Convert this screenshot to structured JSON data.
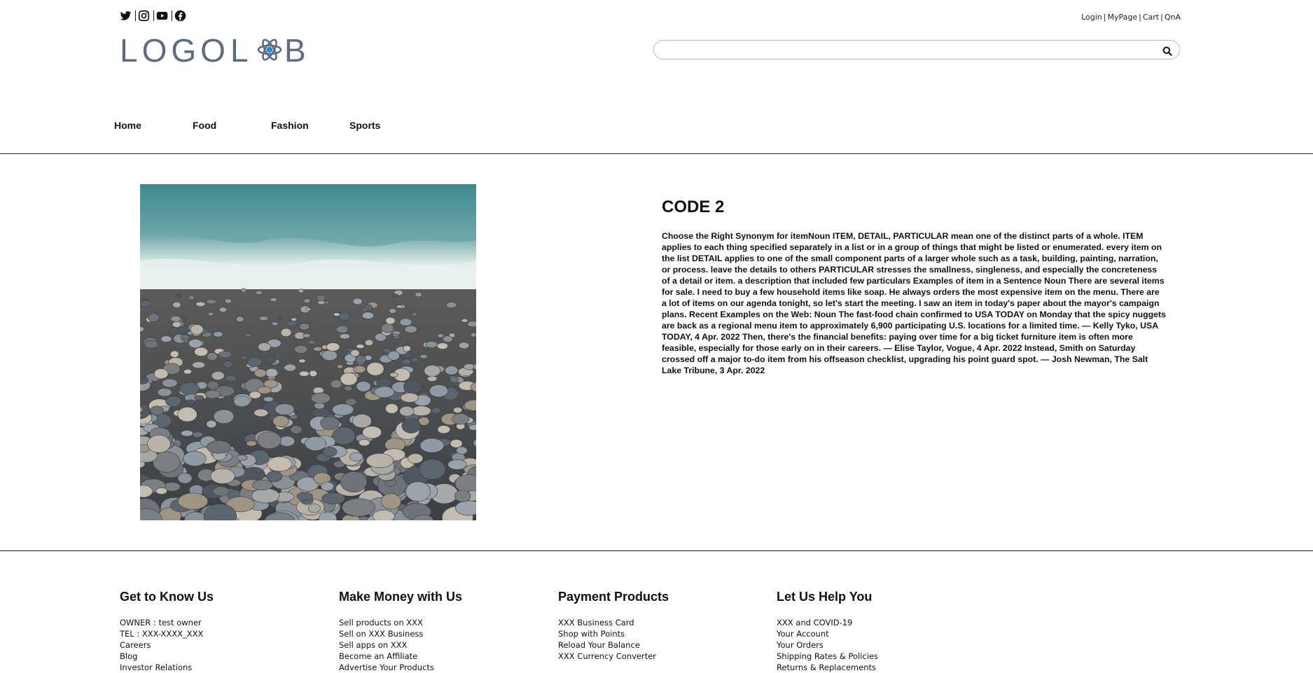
{
  "header": {
    "social": [
      {
        "icon": "twitter-icon"
      },
      {
        "icon": "instagram-icon"
      },
      {
        "icon": "youtube-icon"
      },
      {
        "icon": "facebook-icon"
      }
    ],
    "logo": {
      "part1": "LOGO",
      "part2_pre": "L",
      "part2_post": "B",
      "color": "#5f6b80",
      "accent": "#1f8fd6"
    },
    "top_links": {
      "login": "Login",
      "mypage": "MyPage",
      "cart": "Cart",
      "qna": "QnA",
      "separator": "|"
    },
    "search": {
      "placeholder": "",
      "value": ""
    }
  },
  "nav": {
    "items": [
      {
        "label": "Home"
      },
      {
        "label": "Food"
      },
      {
        "label": "Fashion"
      },
      {
        "label": "Sports"
      }
    ]
  },
  "product": {
    "title": "CODE 2",
    "description": "Choose the Right Synonym for itemNoun ITEM, DETAIL, PARTICULAR mean one of the distinct parts of a whole. ITEM applies to each thing specified separately in a list or in a group of things that might be listed or enumerated. every item on the list DETAIL applies to one of the small component parts of a larger whole such as a task, building, painting, narration, or process. leave the details to others PARTICULAR stresses the smallness, singleness, and especially the concreteness of a detail or item. a description that included few particulars Examples of item in a Sentence Noun There are several items for sale. I need to buy a few household items like soap. He always orders the most expensive item on the menu. There are a lot of items on our agenda tonight, so let's start the meeting. I saw an item in today's paper about the mayor's campaign plans. Recent Examples on the Web: Noun The fast-food chain confirmed to USA TODAY on Monday that the spicy nuggets are back as a regional menu item to approximately 6,900 participating U.S. locations for a limited time. — Kelly Tyko, USA TODAY, 4 Apr. 2022 Then, there's the financial benefits: paying over time for a big ticket furniture item is often more feasible, especially for those early on in their careers. — Elise Taylor, Vogue, 4 Apr. 2022 Instead, Smith on Saturday crossed off a major to-do item from his offseason checklist, upgrading his point guard spot. — Josh Newman, The Salt Lake Tribune, 3 Apr. 2022"
  },
  "footer": {
    "columns": [
      {
        "heading": "Get to Know Us",
        "items": [
          "OWNER : test owner",
          "TEL : XXX-XXXX_XXX",
          "Careers",
          "Blog",
          "Investor Relations"
        ]
      },
      {
        "heading": "Make Money with Us",
        "items": [
          "Sell products on XXX",
          "Sell on XXX Business",
          "Sell apps on XXX",
          "Become an Affiliate",
          "Advertise Your Products"
        ]
      },
      {
        "heading": "Payment Products",
        "items": [
          "XXX Business Card",
          "Shop with Points",
          "Reload Your Balance",
          "XXX Currency Converter"
        ]
      },
      {
        "heading": "Let Us Help You",
        "items": [
          "XXX and COVID-19",
          "Your Account",
          "Your Orders",
          "Shipping Rates & Policies",
          "Returns & Replacements"
        ]
      }
    ]
  }
}
